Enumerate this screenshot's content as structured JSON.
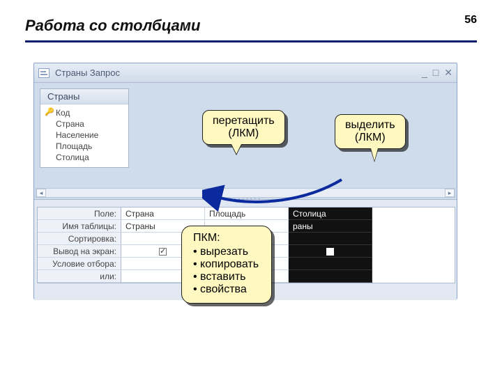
{
  "slide": {
    "title": "Работа со столбцами",
    "number": "56"
  },
  "window": {
    "title": "Страны Запрос",
    "fields_header": "Страны",
    "fields": [
      "Код",
      "Страна",
      "Население",
      "Площадь",
      "Столица"
    ]
  },
  "grid": {
    "labels": [
      "Поле:",
      "Имя таблицы:",
      "Сортировка:",
      "Вывод на экран:",
      "Условие отбора:",
      "или:"
    ],
    "cols": [
      {
        "field": "Страна",
        "table": "Страны",
        "show": true,
        "selected": false
      },
      {
        "field": "Площадь",
        "table": "",
        "show": true,
        "selected": false
      },
      {
        "field": "Столица",
        "table": "раны",
        "show": true,
        "selected": true
      }
    ]
  },
  "callouts": {
    "drag": {
      "l1": "перетащить",
      "l2": "(ЛКМ)"
    },
    "select": {
      "l1": "выделить",
      "l2": "(ЛКМ)"
    },
    "rmb": {
      "title": "ПКМ:",
      "items": [
        "вырезать",
        "копировать",
        "вставить",
        "свойства"
      ]
    }
  },
  "win_controls": {
    "min": "_",
    "max": "□",
    "close": "✕"
  }
}
